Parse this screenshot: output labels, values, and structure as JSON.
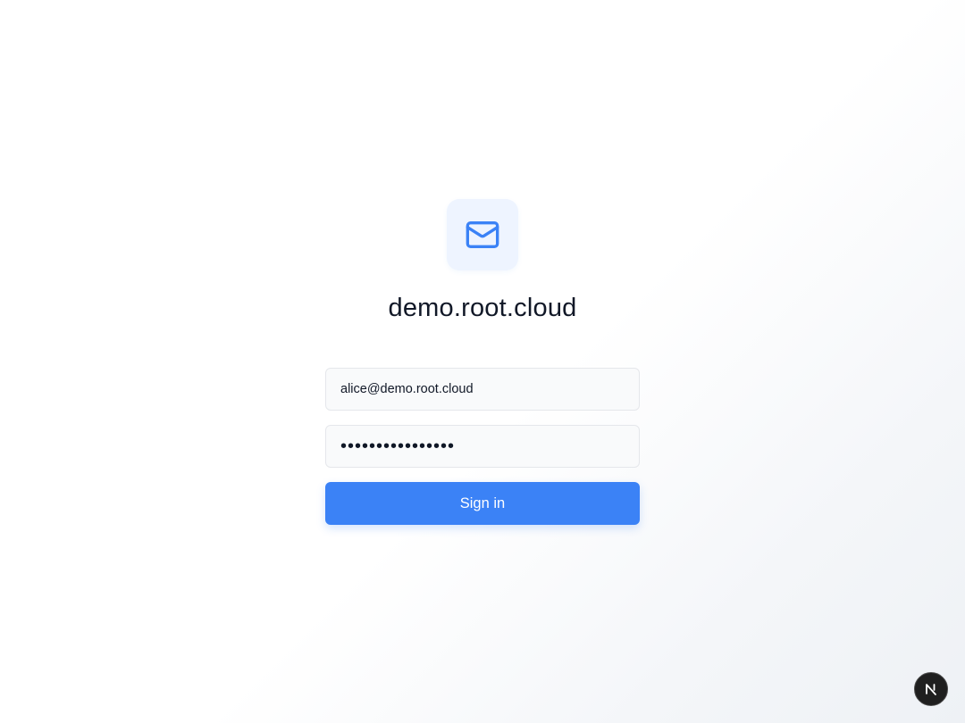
{
  "icons": {
    "logo": "mail-icon",
    "dev_badge": "nextjs-icon"
  },
  "colors": {
    "accent": "#3b82f6",
    "logo_bg": "#eef4ff",
    "title": "#111827",
    "field_bg": "#f9fafb",
    "field_border": "#e5e7eb"
  },
  "login": {
    "title": "demo.root.cloud",
    "email_value": "alice@demo.root.cloud",
    "password_value": "xxxxxxxxxxxxxxxx",
    "signin_label": "Sign in"
  }
}
